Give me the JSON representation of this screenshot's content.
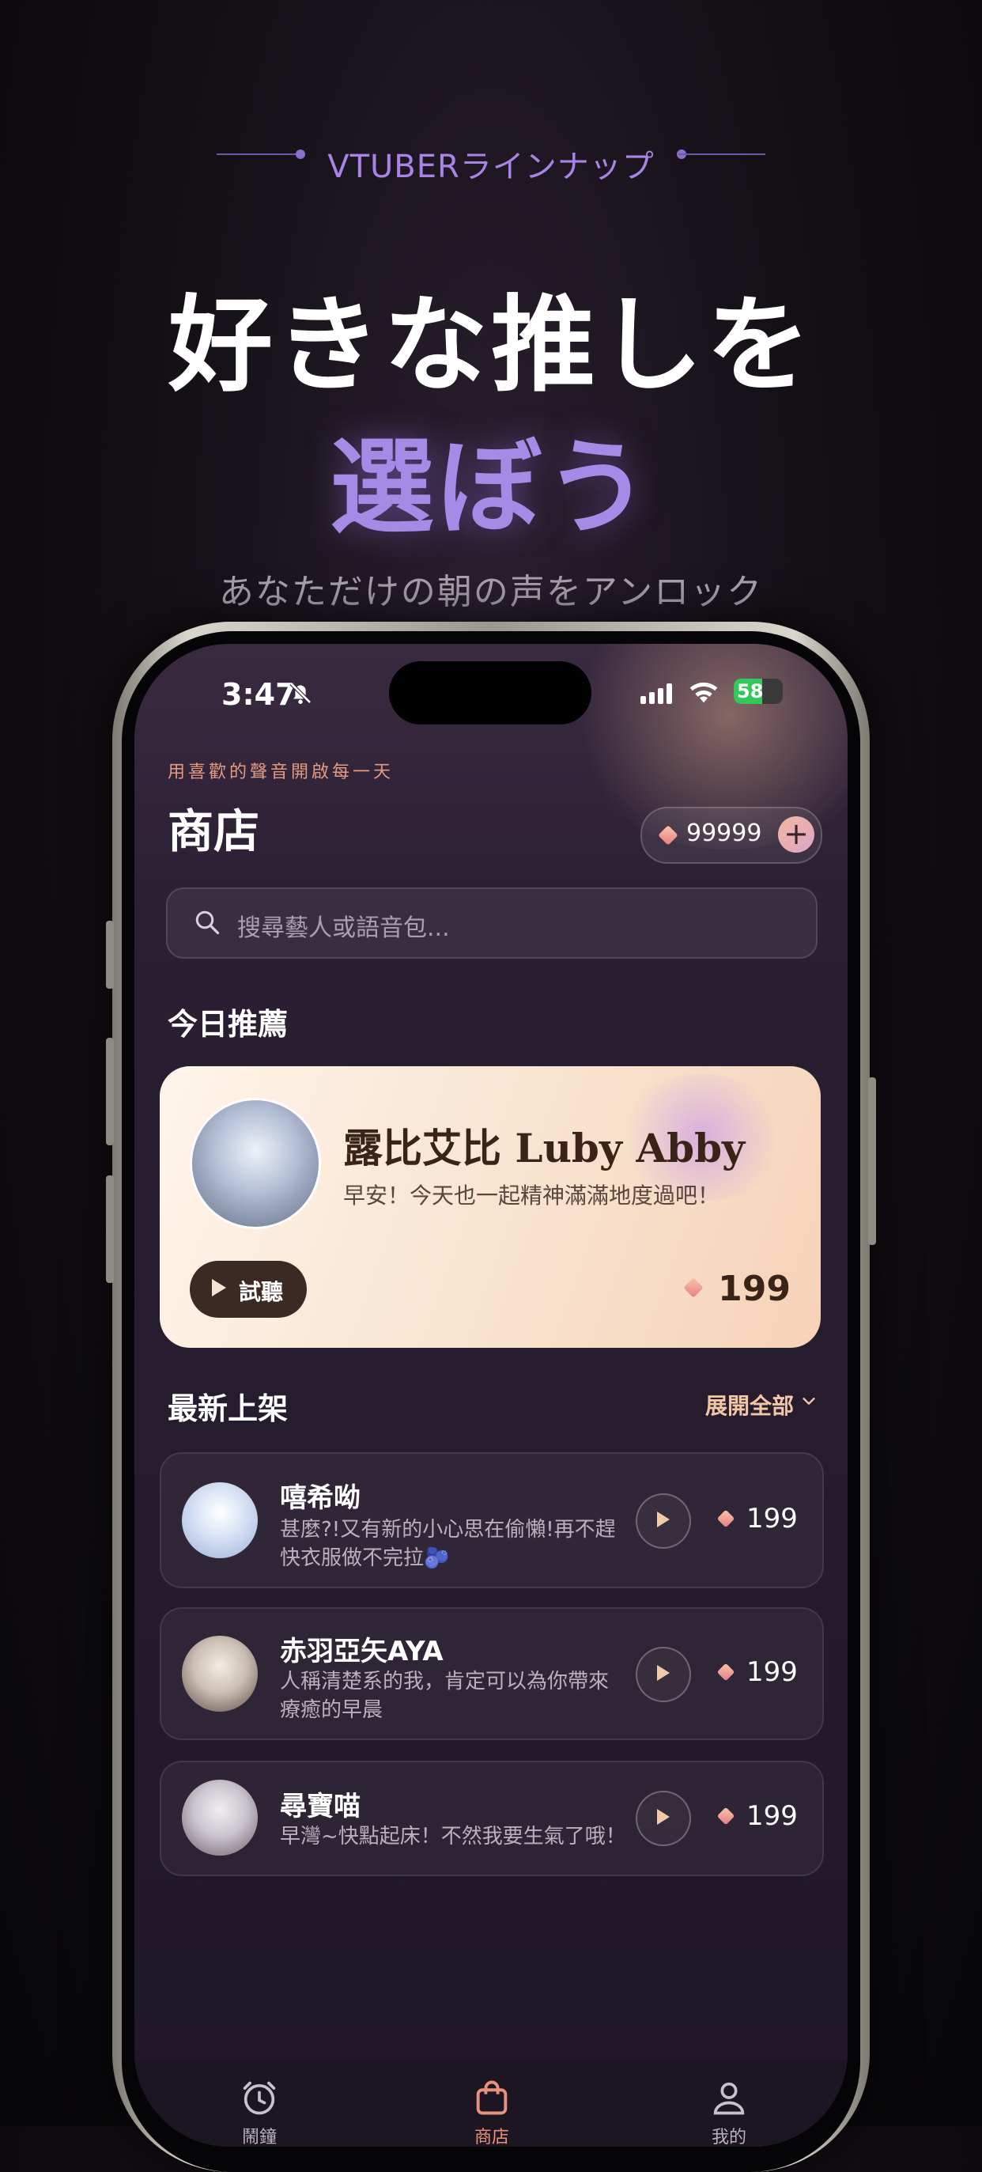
{
  "promo": {
    "kicker": "VTUBERラインナップ",
    "headline_line1": "好きな推しを",
    "headline_line2": "選ぼう",
    "subline": "あなただけの朝の声をアンロック"
  },
  "status_bar": {
    "time": "3:47",
    "battery": "58"
  },
  "header": {
    "tagline": "用喜歡的聲音開啟每一天",
    "title": "商店",
    "coins": "99999",
    "add_coins_label": "+"
  },
  "search": {
    "placeholder": "搜尋藝人或語音包..."
  },
  "featured": {
    "section_title": "今日推薦",
    "name": "露比艾比 Luby Abby",
    "description": "早安！今天也一起精神滿滿地度過吧！",
    "listen_label": "試聽",
    "price": "199"
  },
  "new_arrivals": {
    "section_title": "最新上架",
    "expand_label": "展開全部",
    "items": [
      {
        "name": "嘻希呦",
        "description": "甚麼?!又有新的小心思在偷懶!再不趕快衣服做不完拉🫐",
        "price": "199"
      },
      {
        "name": "赤羽亞矢AYA",
        "description": "人稱清楚系的我，肯定可以為你帶來療癒的早晨",
        "price": "199"
      },
      {
        "name": "尋寶喵",
        "description": "早灣~快點起床！不然我要生氣了哦！",
        "price": "199"
      }
    ]
  },
  "tabbar": {
    "tabs": [
      {
        "label": "鬧鐘",
        "icon": "alarm-clock-icon"
      },
      {
        "label": "商店",
        "icon": "shopping-bag-icon",
        "active": true
      },
      {
        "label": "我的",
        "icon": "user-icon"
      }
    ]
  },
  "colors": {
    "accent_purple": "#a58be6",
    "accent_peach": "#f1c7a6",
    "tab_active": "#e9917a"
  }
}
